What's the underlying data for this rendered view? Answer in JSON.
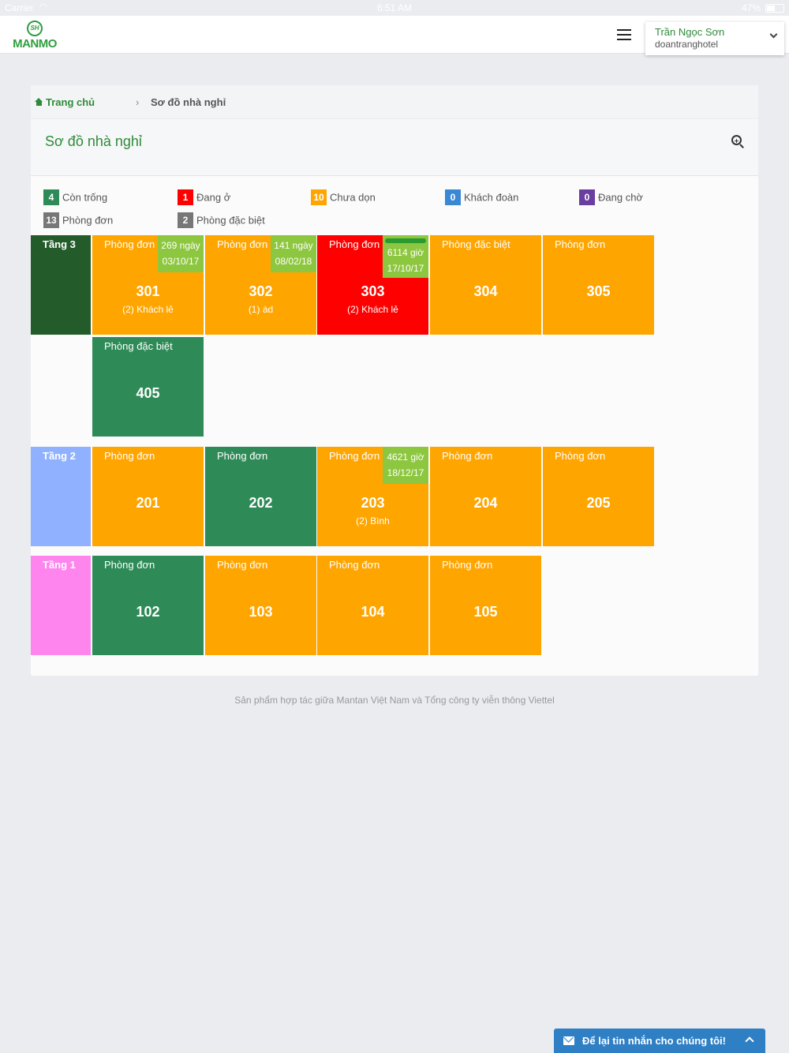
{
  "status_bar": {
    "carrier": "Carrier",
    "time": "6:51 AM",
    "battery": "47%"
  },
  "header": {
    "logo_mark": "SH",
    "logo_text": "MANMO",
    "user_name": "Trần Ngọc Sơn",
    "hotel_name": "doantranghotel"
  },
  "breadcrumb": {
    "home": "Trang chủ",
    "separator": "›",
    "current": "Sơ đồ nhà nghỉ"
  },
  "card": {
    "title": "Sơ đồ nhà nghỉ"
  },
  "legend": [
    {
      "count": "4",
      "label": "Còn trống",
      "color": "#2e8b57"
    },
    {
      "count": "1",
      "label": "Đang ở",
      "color": "#ff0000"
    },
    {
      "count": "10",
      "label": "Chưa dọn",
      "color": "#ffa500"
    },
    {
      "count": "0",
      "label": "Khách đoàn",
      "color": "#3a87d4"
    },
    {
      "count": "0",
      "label": "Đang chờ",
      "color": "#6a3ea1"
    },
    {
      "count": "13",
      "label": "Phòng đơn",
      "color": "#777777"
    },
    {
      "count": "2",
      "label": "Phòng đặc biệt",
      "color": "#777777"
    }
  ],
  "floors": [
    {
      "label": "Tầng 3",
      "color": "#235c2a",
      "rooms": [
        {
          "type": "Phòng đơn",
          "number": "301",
          "guest": "(2) Khách lẻ",
          "color": "#ffa500",
          "badge_line1": "269 ngày",
          "badge_line2": "03/10/17"
        },
        {
          "type": "Phòng đơn",
          "number": "302",
          "guest": "(1) ád",
          "color": "#ffa500",
          "badge_line1": "141 ngày",
          "badge_line2": "08/02/18"
        },
        {
          "type": "Phòng đơn",
          "number": "303",
          "guest": "(2) Khách lẻ",
          "color": "#ff0000",
          "badge_line1": "6114 giờ",
          "badge_line2": "17/10/17",
          "progress": 1.0
        },
        {
          "type": "Phòng đặc biệt",
          "number": "304",
          "guest": "",
          "color": "#ffa500"
        },
        {
          "type": "Phòng đơn",
          "number": "305",
          "guest": "",
          "color": "#ffa500"
        },
        {
          "type": "Phòng đặc biệt",
          "number": "405",
          "guest": "",
          "color": "#2e8b57"
        }
      ]
    },
    {
      "label": "Tầng 2",
      "color": "#8fb1ff",
      "rooms": [
        {
          "type": "Phòng đơn",
          "number": "201",
          "guest": "",
          "color": "#ffa500"
        },
        {
          "type": "Phòng đơn",
          "number": "202",
          "guest": "",
          "color": "#2e8b57"
        },
        {
          "type": "Phòng đơn",
          "number": "203",
          "guest": "(2) Bình",
          "color": "#ffa500",
          "badge_line1": "4621 giờ",
          "badge_line2": "18/12/17"
        },
        {
          "type": "Phòng đơn",
          "number": "204",
          "guest": "",
          "color": "#ffa500"
        },
        {
          "type": "Phòng đơn",
          "number": "205",
          "guest": "",
          "color": "#ffa500"
        }
      ]
    },
    {
      "label": "Tầng 1",
      "color": "#ff85ee",
      "rooms": [
        {
          "type": "Phòng đơn",
          "number": "102",
          "guest": "",
          "color": "#2e8b57"
        },
        {
          "type": "Phòng đơn",
          "number": "103",
          "guest": "",
          "color": "#ffa500"
        },
        {
          "type": "Phòng đơn",
          "number": "104",
          "guest": "",
          "color": "#ffa500"
        },
        {
          "type": "Phòng đơn",
          "number": "105",
          "guest": "",
          "color": "#ffa500"
        }
      ]
    }
  ],
  "footer": "Sản phẩm hợp tác giữa Mantan Việt Nam và Tổng công ty viễn thông Viettel",
  "chat": {
    "label": "Để lại tin nhắn cho chúng tôi!"
  }
}
